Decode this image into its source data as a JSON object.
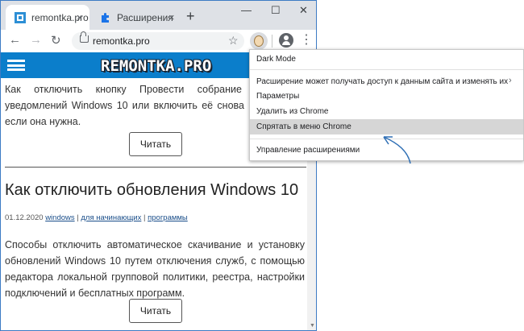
{
  "tabs": [
    {
      "title": "remontka.pro",
      "close": "×",
      "active": true
    },
    {
      "title": "Расширения",
      "close": "×",
      "active": false
    }
  ],
  "new_tab": "+",
  "window_controls": {
    "minimize": "—",
    "maximize": "☐",
    "close": "✕"
  },
  "nav": {
    "back": "←",
    "forward": "→",
    "reload": "↻",
    "url": "remontka.pro",
    "bookmark": "☆",
    "menu": "⋮"
  },
  "site": {
    "logo": "REMONTKA.PRO",
    "article1_text": "Как отключить кнопку Провести собрание и значок уведомлений Windows 10 или включить её снова и добавить, если она нужна.",
    "read_label": "Читать",
    "article2": {
      "title": "Как отключить обновления Windows 10",
      "date": "01.12.2020",
      "sep": "|",
      "categories": [
        "windows",
        "для начинающих",
        "программы"
      ],
      "text": "Способы отключить автоматическое скачивание и установку обновлений Windows 10 путем отключения служб, с помощью редактора локальной групповой политики, реестра, настройки подключений и бесплатных программ."
    }
  },
  "context_menu": {
    "items": [
      {
        "label": "Dark Mode"
      },
      {
        "label": "Расширение может получать доступ к данным сайта и изменять их",
        "chevron": "›"
      },
      {
        "label": "Параметры"
      },
      {
        "label": "Удалить из Chrome"
      },
      {
        "label": "Спрятать в меню Chrome",
        "highlighted": true
      },
      {
        "label": "Управление расширениями"
      }
    ]
  },
  "colors": {
    "header": "#0b7ecb",
    "arrow": "#2f6fb5",
    "highlight": "#d6d6d6"
  }
}
